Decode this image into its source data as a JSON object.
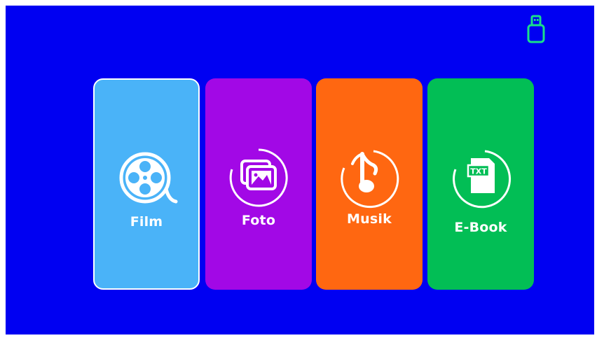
{
  "status": {
    "usb_icon": "usb-drive-icon",
    "usb_color": "#19e08a"
  },
  "menu": {
    "items": [
      {
        "label": "Film",
        "icon": "film-reel-icon",
        "color": "#4ab3f8",
        "selected": true
      },
      {
        "label": "Foto",
        "icon": "photo-gallery-icon",
        "color": "#a208e6",
        "selected": false
      },
      {
        "label": "Musik",
        "icon": "music-note-icon",
        "color": "#ff6711",
        "selected": false
      },
      {
        "label": "E-Book",
        "icon": "txt-document-icon",
        "color": "#02be55",
        "selected": false
      }
    ]
  },
  "colors": {
    "background": "#0000f2",
    "text": "#ffffff"
  }
}
